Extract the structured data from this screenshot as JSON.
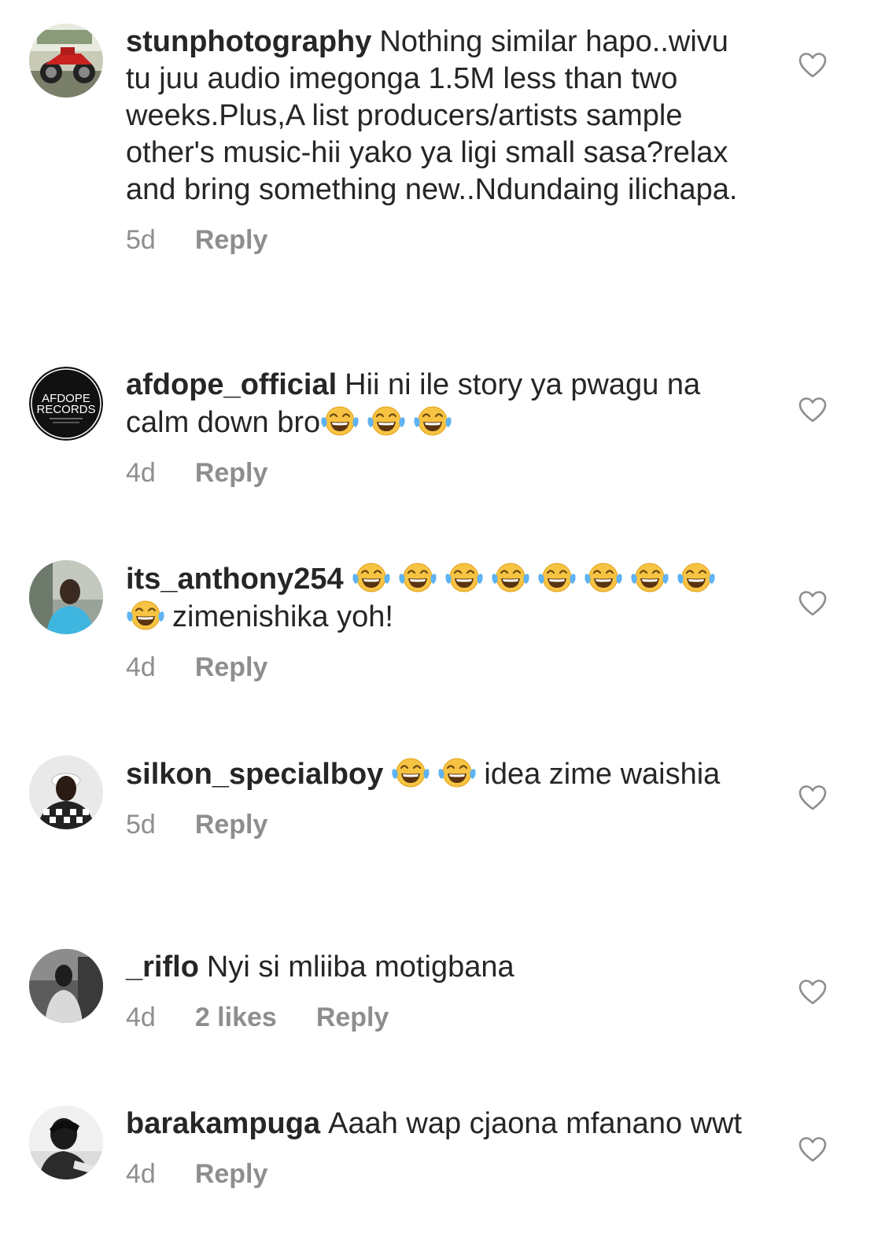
{
  "comments": [
    {
      "username": "stunphotography",
      "text_parts": [
        {
          "t": "text",
          "v": "Nothing similar hapo..wivu tu juu audio imegonga 1.5M less than two weeks.Plus,A list producers/artists sample other's music-hii yako ya ligi small sasa?relax and bring something new..Ndundaing ilichapa."
        }
      ],
      "time": "5d",
      "likes": "",
      "reply": "Reply",
      "avatar": "motorcycle"
    },
    {
      "username": "afdope_official",
      "text_parts": [
        {
          "t": "text",
          "v": "Hii ni ile story ya pwagu na  calm down bro"
        },
        {
          "t": "emoji",
          "v": "joy-emoji"
        },
        {
          "t": "emoji",
          "v": "joy-emoji"
        },
        {
          "t": "emoji",
          "v": "joy-emoji"
        }
      ],
      "time": "4d",
      "likes": "",
      "reply": "Reply",
      "avatar": "records-logo",
      "avatar_text_line1": "AFDOPE",
      "avatar_text_line2": "RECORDS"
    },
    {
      "username": "its_anthony254",
      "text_parts": [
        {
          "t": "emoji",
          "v": "joy-emoji"
        },
        {
          "t": "emoji",
          "v": "joy-emoji"
        },
        {
          "t": "emoji",
          "v": "joy-emoji"
        },
        {
          "t": "emoji",
          "v": "joy-emoji"
        },
        {
          "t": "emoji",
          "v": "joy-emoji"
        },
        {
          "t": "emoji",
          "v": "joy-emoji"
        },
        {
          "t": "emoji",
          "v": "joy-emoji"
        },
        {
          "t": "emoji",
          "v": "joy-emoji"
        },
        {
          "t": "emoji",
          "v": "joy-emoji"
        },
        {
          "t": "text",
          "v": "zimenishika yoh!"
        }
      ],
      "time": "4d",
      "likes": "",
      "reply": "Reply",
      "avatar": "person-blue"
    },
    {
      "username": "silkon_specialboy",
      "text_parts": [
        {
          "t": "emoji",
          "v": "joy-emoji"
        },
        {
          "t": "emoji",
          "v": "joy-emoji"
        },
        {
          "t": "text",
          "v": "idea zime waishia"
        }
      ],
      "time": "5d",
      "likes": "",
      "reply": "Reply",
      "avatar": "person-checkered"
    },
    {
      "username": "_riflo",
      "text_parts": [
        {
          "t": "text",
          "v": "Nyi si mliiba motigbana"
        }
      ],
      "time": "4d",
      "likes": "2 likes",
      "reply": "Reply",
      "avatar": "person-dark"
    },
    {
      "username": "barakampuga",
      "text_parts": [
        {
          "t": "text",
          "v": "Aaah wap cjaona mfanano wwt"
        }
      ],
      "time": "4d",
      "likes": "",
      "reply": "Reply",
      "avatar": "person-bw"
    }
  ],
  "icons": {
    "heart": "heart-outline-icon",
    "emoji": "face-with-tears-of-joy"
  },
  "colors": {
    "username": "#262626",
    "text": "#262626",
    "meta": "#8e8e8e",
    "heart_stroke": "#8e8e8e"
  }
}
